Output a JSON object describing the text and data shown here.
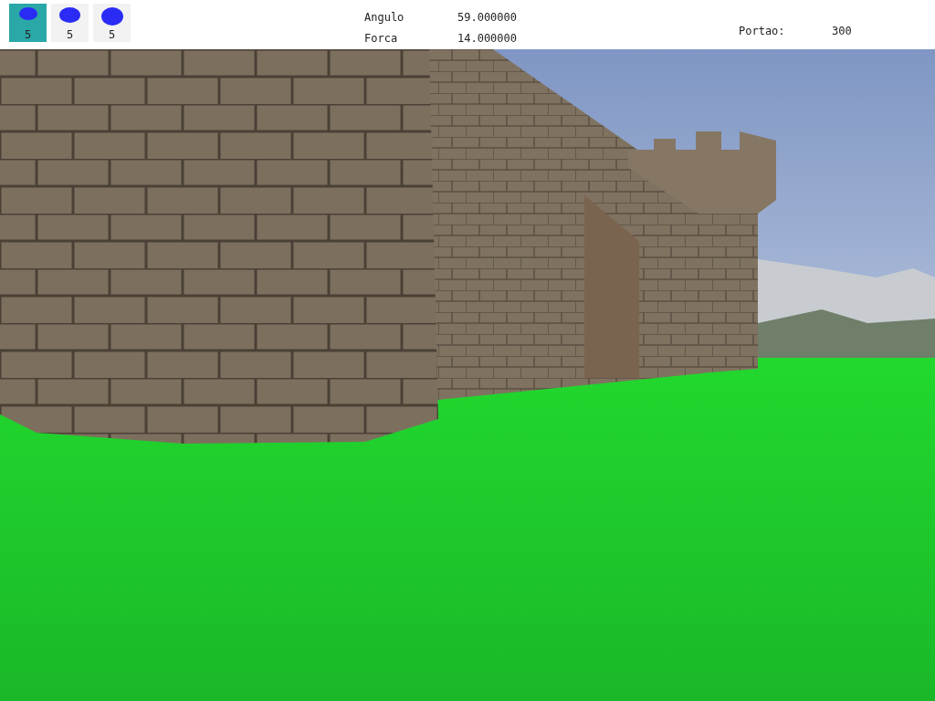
{
  "ammo_slots": [
    {
      "kind": "small",
      "count": "5",
      "selected": true
    },
    {
      "kind": "medium",
      "count": "5",
      "selected": false
    },
    {
      "kind": "large",
      "count": "5",
      "selected": false
    }
  ],
  "stats": [
    {
      "label": "Angulo",
      "value": "59.000000"
    },
    {
      "label": "Forca",
      "value": "14.000000"
    }
  ],
  "gate": {
    "label": "Portao:",
    "value": "300"
  }
}
